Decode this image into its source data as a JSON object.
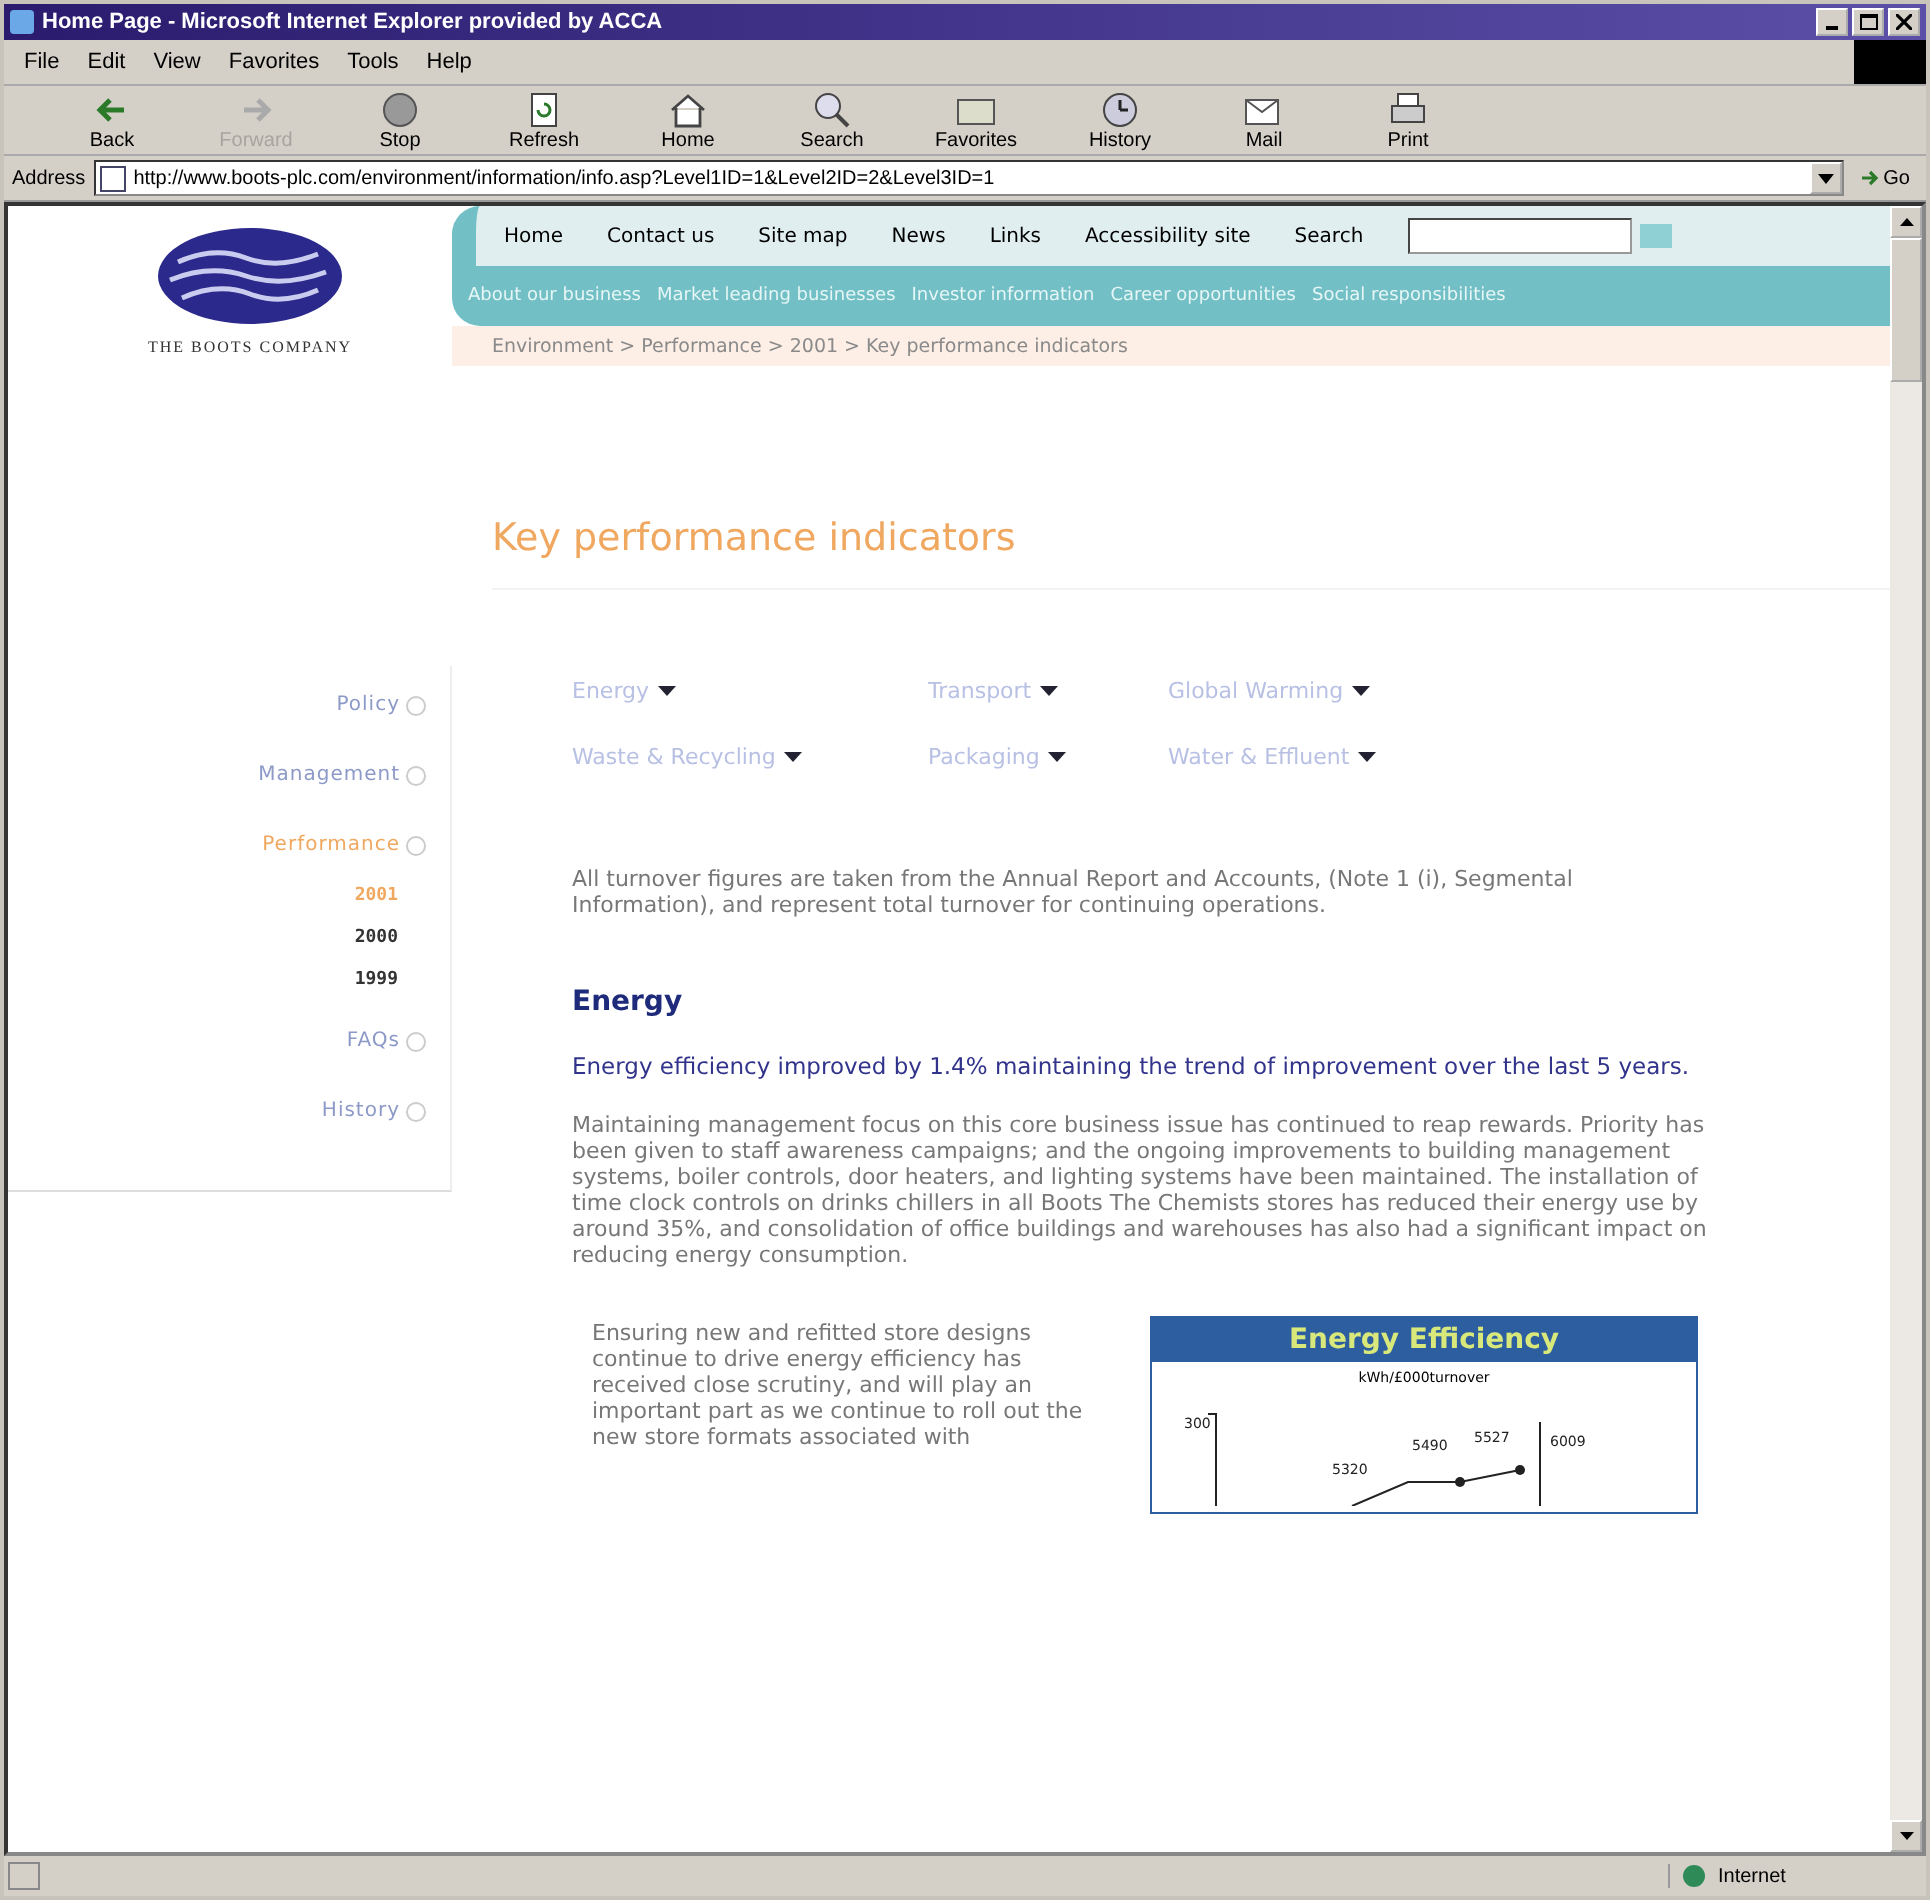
{
  "window": {
    "title": "Home Page - Microsoft Internet Explorer provided by ACCA"
  },
  "menu": [
    "File",
    "Edit",
    "View",
    "Favorites",
    "Tools",
    "Help"
  ],
  "toolbar": [
    {
      "label": "Back",
      "kind": "back",
      "disabled": false
    },
    {
      "label": "Forward",
      "kind": "forward",
      "disabled": true
    },
    {
      "label": "Stop",
      "kind": "stop",
      "disabled": false
    },
    {
      "label": "Refresh",
      "kind": "refresh",
      "disabled": false
    },
    {
      "label": "Home",
      "kind": "home",
      "disabled": false
    },
    {
      "label": "Search",
      "kind": "search",
      "disabled": false
    },
    {
      "label": "Favorites",
      "kind": "favorites",
      "disabled": false
    },
    {
      "label": "History",
      "kind": "history",
      "disabled": false
    },
    {
      "label": "Mail",
      "kind": "mail",
      "disabled": false
    },
    {
      "label": "Print",
      "kind": "print",
      "disabled": false
    }
  ],
  "address": {
    "label": "Address",
    "url": "http://www.boots-plc.com/environment/information/info.asp?Level1ID=1&Level2ID=2&Level3ID=1",
    "go": "Go"
  },
  "site": {
    "logo_text": "THE BOOTS COMPANY",
    "top_nav": [
      "Home",
      "Contact us",
      "Site map",
      "News",
      "Links",
      "Accessibility site"
    ],
    "search_label": "Search",
    "main_nav": [
      "About our business",
      "Market leading businesses",
      "Investor information",
      "Career opportunities",
      "Social responsibilities"
    ],
    "breadcrumb": "Environment > Performance > 2001 > Key performance indicators",
    "sidebar": [
      {
        "label": "Policy",
        "selected": false
      },
      {
        "label": "Management",
        "selected": false
      },
      {
        "label": "Performance",
        "selected": true,
        "children": [
          {
            "label": "2001",
            "selected": true
          },
          {
            "label": "2000",
            "selected": false
          },
          {
            "label": "1999",
            "selected": false
          }
        ]
      },
      {
        "label": "FAQs",
        "selected": false
      },
      {
        "label": "History",
        "selected": false
      }
    ],
    "heading": "Key performance indicators",
    "topics": [
      "Energy",
      "Transport",
      "Global Warming",
      "Waste & Recycling",
      "Packaging",
      "Water & Effluent"
    ],
    "intro": "All turnover figures are taken from the Annual Report and Accounts, (Note 1 (i), Segmental Information), and represent total turnover for continuing operations.",
    "section_title": "Energy",
    "summary": "Energy efficiency improved by 1.4% maintaining the trend of improvement over the last 5 years.",
    "body": "Maintaining management focus on this core business issue has continued to reap rewards. Priority has been given to staff awareness campaigns; and the ongoing improvements to building management systems, boiler controls, door heaters, and lighting systems have been maintained. The installation of time clock controls on drinks chillers in all Boots The Chemists stores has reduced their energy use by around 35%, and consolidation of office buildings and warehouses has also had a significant impact on reducing energy consumption.",
    "body2": "Ensuring new and refitted store designs continue to drive energy efficiency has received close scrutiny, and will play an important part as we continue to roll out the new store formats associated with",
    "chart": {
      "title": "Energy Efficiency",
      "subtitle": "kWh/£000turnover",
      "axis_label": "300",
      "point_labels": [
        "5320",
        "5490",
        "5527",
        "6009"
      ]
    }
  },
  "status_bar": {
    "zone": "Internet"
  }
}
